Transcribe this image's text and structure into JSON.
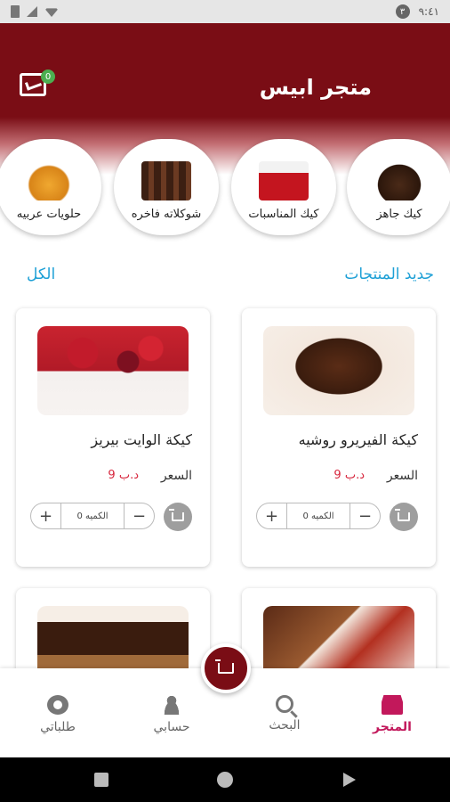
{
  "status_bar": {
    "time": "٩:٤١",
    "notification_badge": "٣"
  },
  "header": {
    "title": "متجر ابيس",
    "cart_count": "0"
  },
  "categories": [
    {
      "label": "كيك جاهز"
    },
    {
      "label": "كيك المناسبات"
    },
    {
      "label": "شوكلاته فاخره"
    },
    {
      "label": "حلويات عربيه"
    }
  ],
  "section": {
    "title": "جديد المنتجات",
    "view_all": "الكل"
  },
  "products": [
    {
      "name": "كيكة الفيريرو روشيه",
      "price_label": "السعر",
      "price": "9 د.ب",
      "qty_placeholder": "الكميه 0",
      "plus": "+",
      "minus": "−"
    },
    {
      "name": "كيكة الوايت بيريز",
      "price_label": "السعر",
      "price": "9 د.ب",
      "qty_placeholder": "الكميه 0",
      "plus": "+",
      "minus": "−"
    }
  ],
  "bottom_nav": [
    {
      "label": "المتجر",
      "icon": "store-icon",
      "active": true
    },
    {
      "label": "البحث",
      "icon": "search-icon"
    },
    {
      "label": "حسابي",
      "icon": "person-icon"
    },
    {
      "label": "طلباتي",
      "icon": "orders-icon"
    }
  ],
  "colors": {
    "primary": "#7a0d15",
    "accent": "#1ea0d6",
    "price": "#d7263d",
    "nav_active": "#c2185b"
  }
}
